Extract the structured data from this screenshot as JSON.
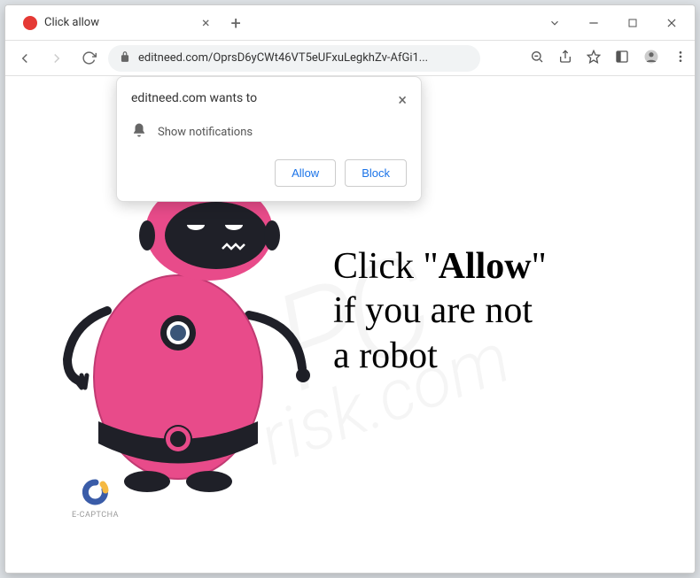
{
  "window": {
    "tab": {
      "title": "Click allow"
    },
    "url_display": "editneed.com/OprsD6yCWt46VT5eUFxuLegkhZv-AfGi1..."
  },
  "permission_dialog": {
    "title": "editneed.com wants to",
    "message": "Show notifications",
    "allow_label": "Allow",
    "block_label": "Block"
  },
  "page": {
    "headline_prefix": "Click \"",
    "headline_bold": "Allow",
    "headline_suffix": "\"",
    "line2": "if you are not",
    "line3": "a robot",
    "captcha_label": "E-CAPTCHA"
  },
  "watermark": {
    "line1": "PC",
    "line2": "risk.com"
  }
}
